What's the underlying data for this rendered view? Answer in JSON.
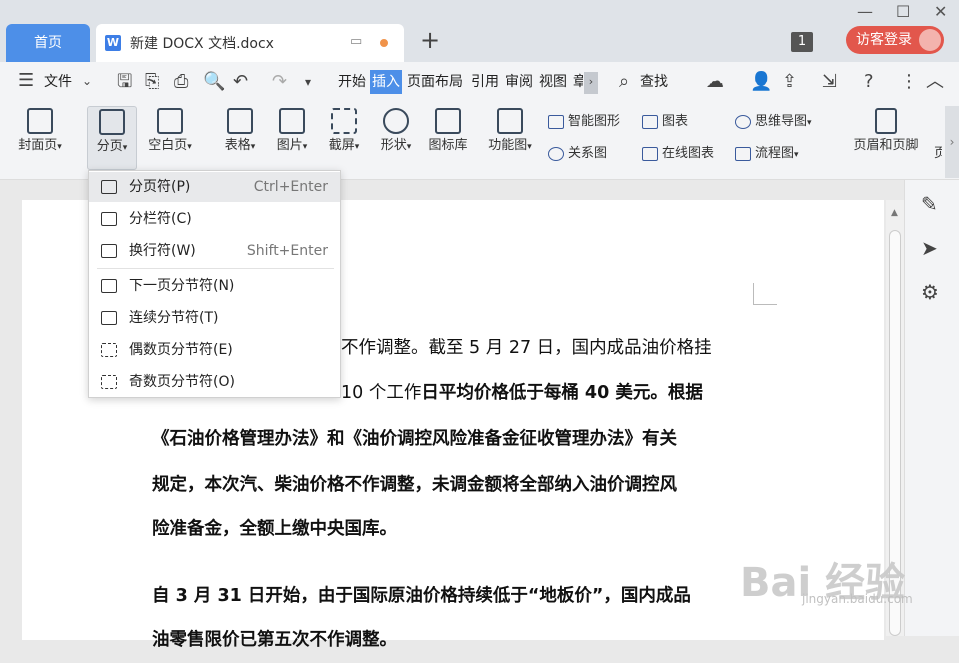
{
  "tabs": {
    "home": "首页",
    "doc_title": "新建 DOCX 文档.docx",
    "add": "+"
  },
  "titlebar": {
    "page_badge": "1",
    "login": "访客登录"
  },
  "menubar": {
    "file": "文件",
    "items": [
      "开始",
      "插入",
      "页面布局",
      "引用",
      "审阅",
      "视图",
      "章"
    ],
    "active": "插入",
    "search": "查找"
  },
  "ribbon": {
    "cover": "封面页",
    "page_break": "分页",
    "blank_page": "空白页",
    "table": "表格",
    "picture": "图片",
    "screenshot": "截屏",
    "shape": "形状",
    "icon_lib": "图标库",
    "func_chart": "功能图",
    "smart_art": "智能图形",
    "chart": "图表",
    "mind_map": "思维导图",
    "relation": "关系图",
    "online_chart": "在线图表",
    "flow_chart": "流程图",
    "header_footer": "页眉和页脚",
    "more": "页"
  },
  "dropdown": {
    "items": [
      {
        "label": "分页符(P)",
        "shortcut": "Ctrl+Enter"
      },
      {
        "label": "分栏符(C)",
        "shortcut": ""
      },
      {
        "label": "换行符(W)",
        "shortcut": "Shift+Enter"
      },
      {
        "label": "下一页分节符(N)",
        "shortcut": ""
      },
      {
        "label": "连续分节符(T)",
        "shortcut": ""
      },
      {
        "label": "偶数页分节符(E)",
        "shortcut": ""
      },
      {
        "label": "奇数页分节符(O)",
        "shortcut": ""
      }
    ]
  },
  "document": {
    "line1": "不作调整。截至 5 月 27 日，国内成品油价格挂",
    "line2_normal": "10 个工作",
    "line2_bold": "日平均价格低于每桶 40 美元。根据",
    "line3": "《石油价格管理办法》和《油价调控风险准备金征收管理办法》有关",
    "line4": "规定，本次汽、柴油价格不作调整，未调金额将全部纳入油价调控风",
    "line5": "险准备金，全额上缴中央国库。",
    "line6": "自 3 月 31 日开始，由于国际原油价格持续低于“地板价”，国内成品",
    "line7": "油零售限价已第五次不作调整。"
  },
  "watermark": {
    "main": "Bai 经验",
    "sub": "jingyan.baidu.com"
  }
}
